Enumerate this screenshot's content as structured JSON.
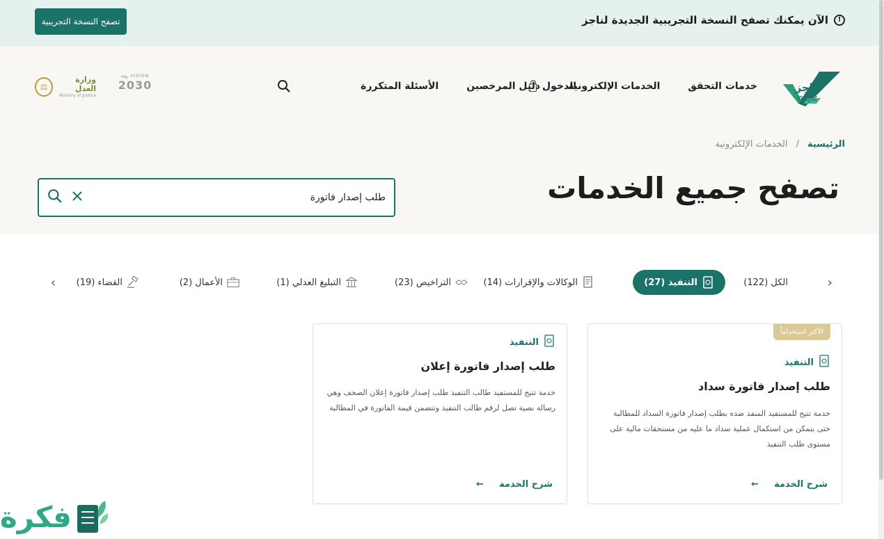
{
  "banner": {
    "message": "الآن يمكنك تصفح النسخة التجريبية الجديدة لناجز",
    "button": "تصفح النسخة التجريبية"
  },
  "header": {
    "logo_word": "ناجز",
    "logo_latin": "najiz",
    "nav": [
      "خدمات التحقق",
      "الخدمات الإلكترونية",
      "دليل المرخصين",
      "الأسئلة المتكررة"
    ],
    "login": "الدخول",
    "vision_top": "VISION رؤية",
    "vision_year": "2030",
    "moj_ar": "وزارة العدل",
    "moj_en": "Ministry of Justice"
  },
  "breadcrumb": {
    "home": "الرئيسية",
    "separator": "/",
    "current": "الخدمات الإلكترونية"
  },
  "page_title": "تصفح جميع الخدمات",
  "search": {
    "value": "طلب إصدار فاتورة",
    "placeholder": ""
  },
  "tabs": [
    {
      "label": "الكل (122)"
    },
    {
      "label": "التنفيذ (27)",
      "active": true
    },
    {
      "label": "الوكالات والإقرارات (14)"
    },
    {
      "label": "التراخيص (23)"
    },
    {
      "label": "التبليغ العدلي (1)"
    },
    {
      "label": "الأعمال (2)"
    },
    {
      "label": "القضاء (19)"
    }
  ],
  "cards": [
    {
      "badge": "الأكثر استخداماً",
      "category": "التنفيذ",
      "title": "طلب إصدار فاتورة سداد",
      "desc": "خدمة تتيح للمستفيد المنفذ ضده بطلب إصدار فاتورة السداد للمطالبة حتى يتمكن من استكمال عملية سداد ما عليه من مستحقات مالية على مستوى طلب التنفيذ",
      "more": "شرح الخدمة"
    },
    {
      "category": "التنفيذ",
      "title": "طلب إصدار فاتورة إعلان",
      "desc": "خدمة تتيح للمستفيد طالب التنفيذ طلب إصدار فاتورة إعلان الصحف وهي رسالة نصية تصل لرقم طالب التنفيذ وتتضمن قيمة الفاتورة في المطالبة",
      "more": "شرح الخدمة"
    }
  ],
  "watermark": "فكرة",
  "colors": {
    "primary": "#1b7268",
    "banner_bg": "#e4f1ec",
    "hero_bg": "#f8f7f3",
    "badge": "#d9c995"
  }
}
